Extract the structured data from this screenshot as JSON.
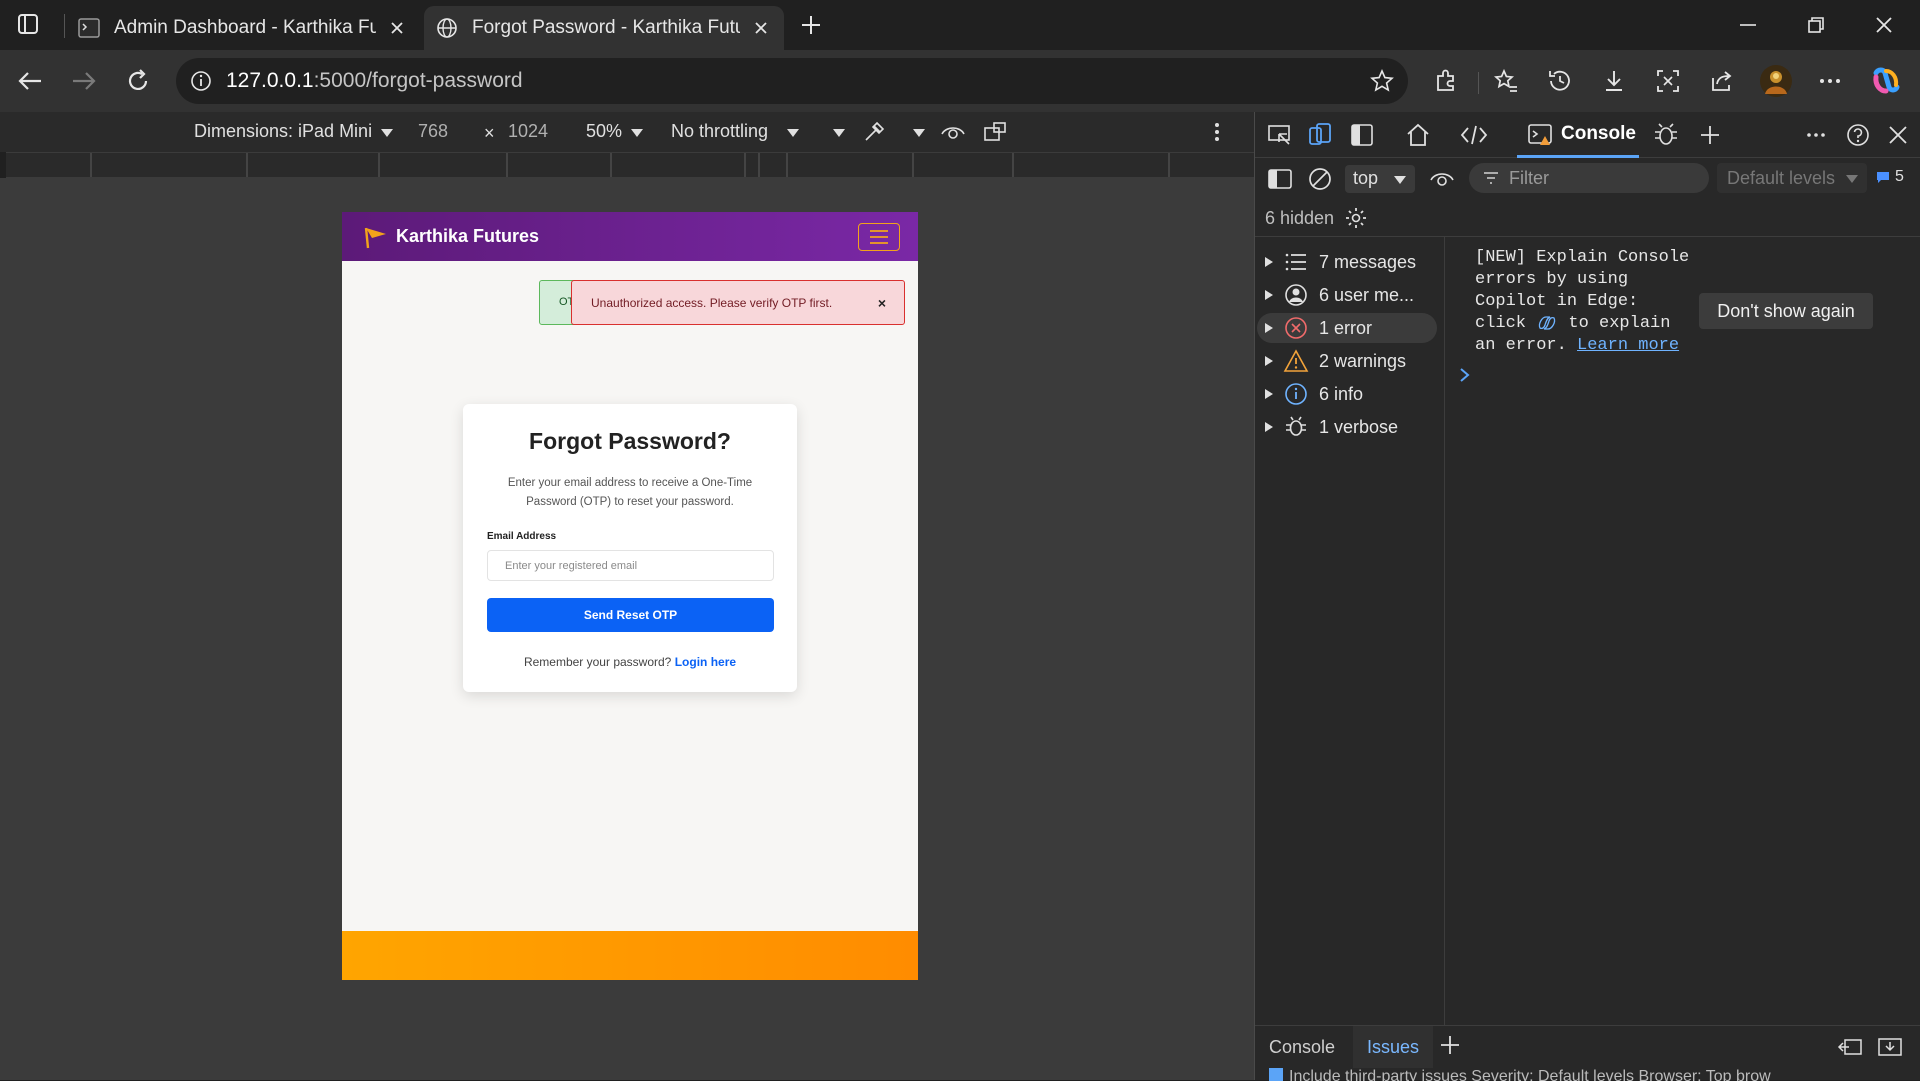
{
  "browser": {
    "tabs": [
      {
        "title": "Admin Dashboard - Karthika Futures"
      },
      {
        "title": "Forgot Password - Karthika Futures"
      }
    ],
    "url_host": "127.0.0.1",
    "url_path": ":5000/forgot-password"
  },
  "device_toolbar": {
    "dimensions": "Dimensions: iPad Mini",
    "width": "768",
    "times": "×",
    "height": "1024",
    "zoom": "50%",
    "throttling": "No throttling"
  },
  "page": {
    "brand": "Karthika Futures",
    "success_alert": "OTP",
    "error_alert": "Unauthorized access. Please verify OTP first.",
    "error_close": "×",
    "card_title": "Forgot Password?",
    "card_description": "Enter your email address to receive a One-Time Password (OTP) to reset your password.",
    "email_label": "Email Address",
    "email_placeholder": "Enter your registered email",
    "submit_label": "Send Reset OTP",
    "remember_text": "Remember your password?",
    "login_link": "Login here",
    "colors": {
      "header": "#6a1f8f",
      "accent": "#ffa500",
      "primary": "#0b62f5"
    }
  },
  "devtools": {
    "active_tab": "Console",
    "context": "top",
    "filter_placeholder": "Filter",
    "levels": "Default levels",
    "issues_count": "5",
    "hidden": "6 hidden",
    "sidebar": [
      {
        "label": "7 messages",
        "icon": "list-icon"
      },
      {
        "label": "6 user me...",
        "icon": "user-icon"
      },
      {
        "label": "1 error",
        "icon": "error-icon"
      },
      {
        "label": "2 warnings",
        "icon": "warning-icon"
      },
      {
        "label": "6 info",
        "icon": "info-icon"
      },
      {
        "label": "1 verbose",
        "icon": "bug-icon"
      }
    ],
    "copilot_message_a": "[NEW] Explain Console errors by using Copilot in Edge: click",
    "copilot_message_b": "to explain an error.",
    "learn_more": "Learn more",
    "dont_show": "Don't show again",
    "drawer_tabs": [
      "Console",
      "Issues"
    ],
    "drawer_sub": "Include third-party issues   Severity:   Default levels   Browser:   Top brow"
  }
}
